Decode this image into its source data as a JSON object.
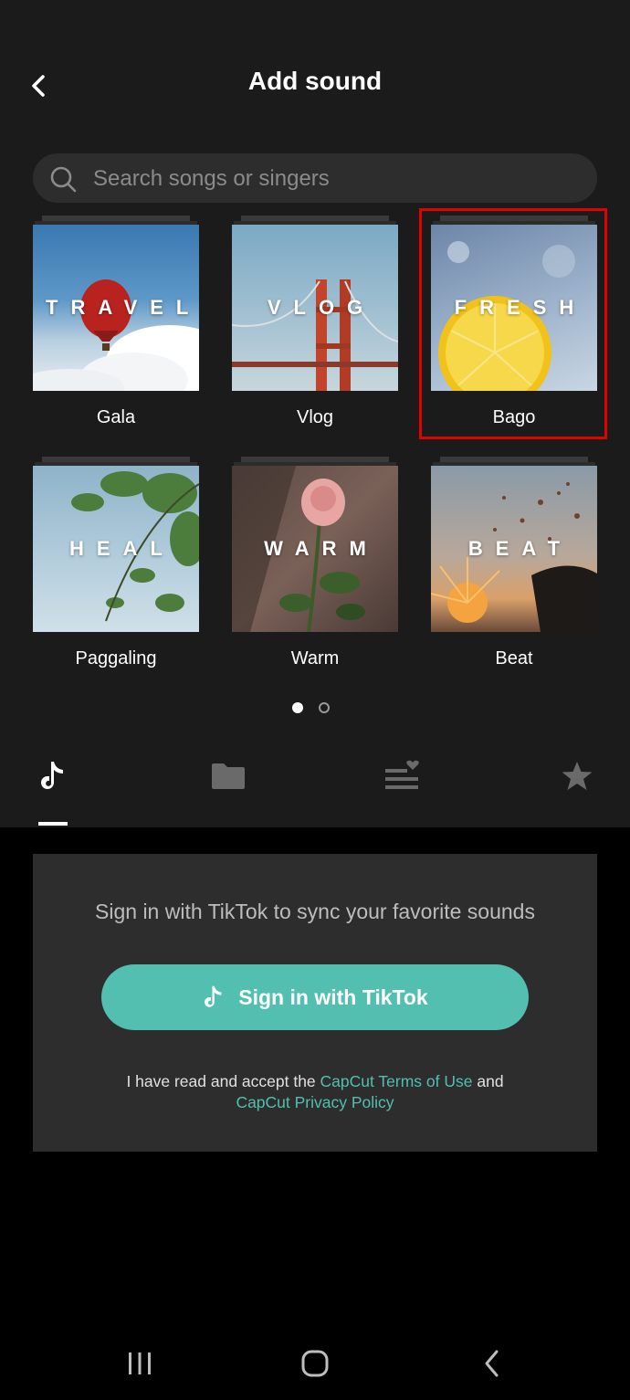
{
  "header": {
    "title": "Add sound"
  },
  "search": {
    "placeholder": "Search songs or singers"
  },
  "categories": [
    {
      "cover_text": "TRAVEL",
      "label": "Gala"
    },
    {
      "cover_text": "VLOG",
      "label": "Vlog"
    },
    {
      "cover_text": "FRESH",
      "label": "Bago"
    },
    {
      "cover_text": "HEAL",
      "label": "Paggaling"
    },
    {
      "cover_text": "WARM",
      "label": "Warm"
    },
    {
      "cover_text": "BEAT",
      "label": "Beat"
    }
  ],
  "pagination": {
    "current": 1,
    "total": 2
  },
  "tabs": [
    {
      "icon": "tiktok-icon",
      "active": true
    },
    {
      "icon": "folder-icon",
      "active": false
    },
    {
      "icon": "playlist-heart-icon",
      "active": false
    },
    {
      "icon": "star-icon",
      "active": false
    }
  ],
  "signin": {
    "message": "Sign in with TikTok to sync your favorite sounds",
    "button_label": "Sign in with TikTok",
    "terms_prefix": "I have read and accept the ",
    "terms_link": "CapCut Terms of Use",
    "terms_and": " and",
    "privacy_link": "CapCut Privacy Policy"
  },
  "colors": {
    "accent": "#52bfb0",
    "highlight": "#e30000",
    "panel": "#1b1b1b",
    "card": "#2d2d2d"
  }
}
